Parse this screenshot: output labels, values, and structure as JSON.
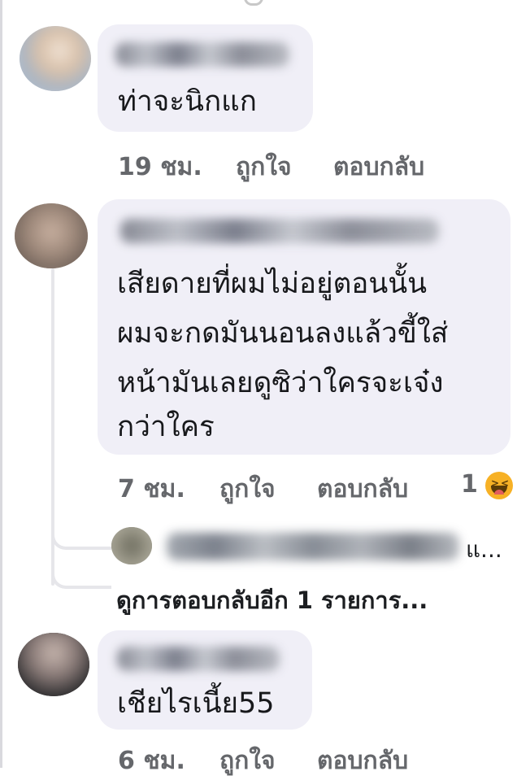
{
  "comments": [
    {
      "text_lines": [
        "ท่าจะนิกแก"
      ],
      "time": "19 ชม.",
      "like": "ถูกใจ",
      "reply": "ตอบกลับ"
    },
    {
      "text_lines": [
        "เสียดายที่ผมไม่อยู่ตอนนั้น",
        "ผมจะกดมันนอนลงแล้วขี้ใส่",
        "หน้ามันเลยดูซิว่าใครจะเจ๋ง",
        "กว่าใคร"
      ],
      "time": "7 ชม.",
      "like": "ถูกใจ",
      "reply": "ตอบกลับ",
      "reaction_count": "1",
      "reaction_icon": "haha-emoji-icon"
    },
    {
      "text_lines": [
        "เชียไรเนี้ย55"
      ],
      "time": "6 ชม.",
      "like": "ถูกใจ",
      "reply": "ตอบกลับ"
    }
  ],
  "nested_reply": {
    "text_suffix": "แ..."
  },
  "more_replies_link": "ดูการตอบกลับอีก 1 รายการ...",
  "colors": {
    "bubble": "#f0eff7",
    "meta_text": "#65676b",
    "main_text": "#17181b",
    "thread_line": "#e6e6ea"
  }
}
